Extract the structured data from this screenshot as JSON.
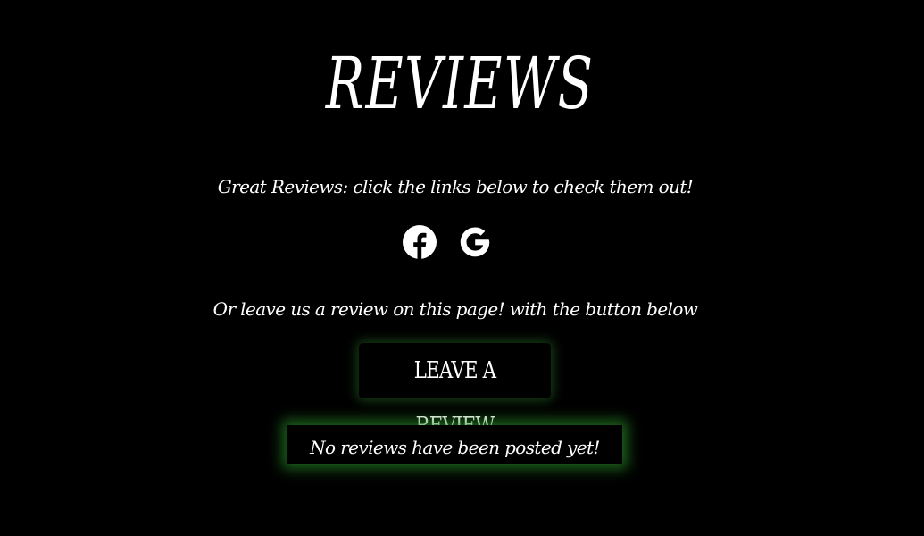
{
  "page": {
    "title": "REVIEWS",
    "intro_text": "Great Reviews: click the links below to check them out!",
    "alt_text": "Or leave us a review on this page! with the button below"
  },
  "socials": {
    "items": [
      {
        "name": "Facebook",
        "icon": "facebook-icon"
      },
      {
        "name": "Google",
        "icon": "google-icon"
      }
    ]
  },
  "actions": {
    "leave_review_label": "LEAVE A REVIEW"
  },
  "reviews": {
    "empty_message": "No reviews have been posted yet!"
  },
  "colors": {
    "background": "#000000",
    "text": "#ffffff",
    "glow": "#2e8b2e"
  }
}
